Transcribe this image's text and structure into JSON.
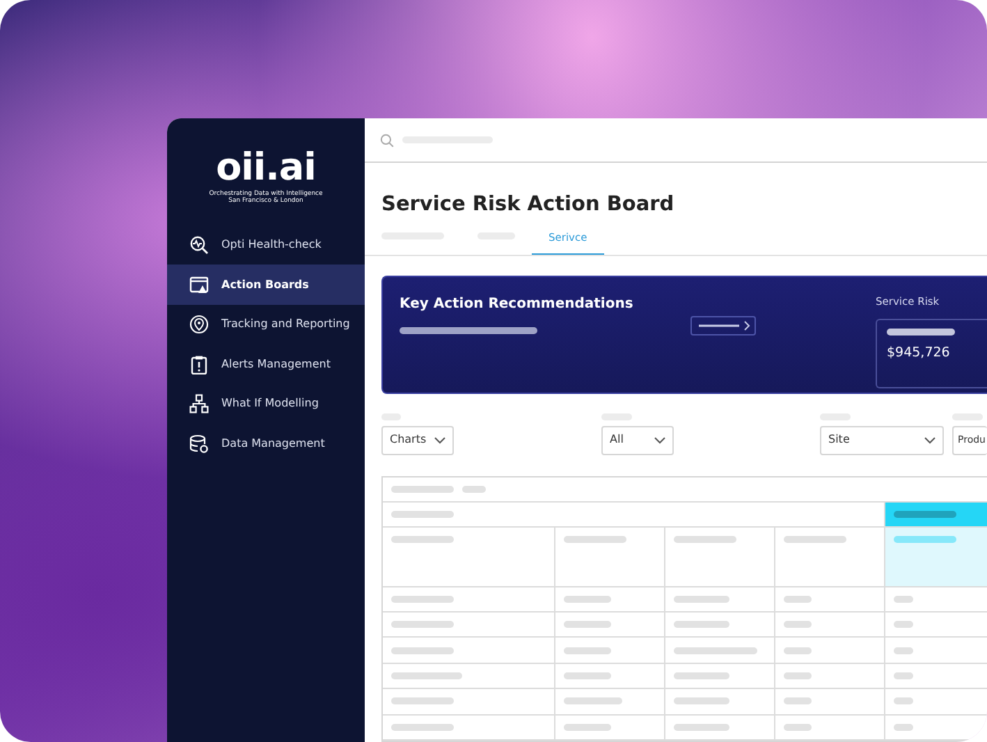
{
  "sidebar": {
    "logo": "oii.ai",
    "tagline": [
      "Orchestrating Data with Intelligence",
      "San Francisco & London"
    ],
    "items": [
      {
        "label": "Opti Health-check",
        "selected": false
      },
      {
        "label": "Action Boards",
        "selected": true
      },
      {
        "label": "Tracking and Reporting",
        "selected": false
      },
      {
        "label": "Alerts Management",
        "selected": false
      },
      {
        "label": "What If Modelling",
        "selected": false
      },
      {
        "label": "Data Management",
        "selected": false
      }
    ]
  },
  "page": {
    "title": "Service Risk Action Board"
  },
  "tabs": [
    {
      "kind": "placeholder",
      "selected": false
    },
    {
      "kind": "placeholder",
      "selected": false
    },
    {
      "kind": "text",
      "label": "Serivce",
      "selected": true
    }
  ],
  "recommendations_card": {
    "title": "Key Action Recommendations",
    "side_label": "Service Risk",
    "value": "$945,726"
  },
  "filters": [
    {
      "value": "Charts"
    },
    {
      "value": "All"
    },
    {
      "value": "Site"
    },
    {
      "value": "Produ"
    }
  ]
}
